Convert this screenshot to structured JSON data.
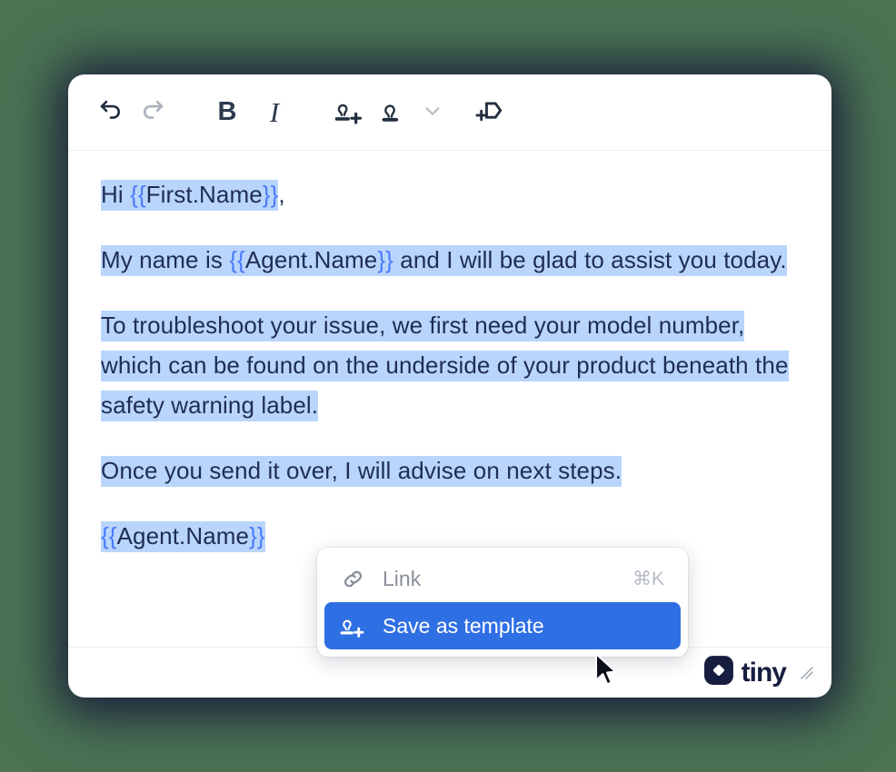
{
  "background_color": "#4a7353",
  "toolbar": {
    "buttons": [
      {
        "name": "undo",
        "label": "Undo",
        "icon": "undo-icon",
        "state": "enabled"
      },
      {
        "name": "redo",
        "label": "Redo",
        "icon": "redo-icon",
        "state": "disabled"
      },
      {
        "name": "bold",
        "label": "B",
        "icon": "bold-icon",
        "state": "enabled"
      },
      {
        "name": "italic",
        "label": "I",
        "icon": "italic-icon",
        "state": "enabled"
      },
      {
        "name": "save-as-template",
        "label": "Save as template",
        "icon": "stamp-plus-icon",
        "state": "enabled"
      },
      {
        "name": "insert-template",
        "label": "Insert template",
        "icon": "stamp-icon",
        "state": "enabled"
      },
      {
        "name": "template-options",
        "label": "Template options",
        "icon": "chevron-down-icon",
        "state": "enabled"
      },
      {
        "name": "insert-merge-tag",
        "label": "Insert merge tag",
        "icon": "tag-plus-icon",
        "state": "enabled"
      }
    ]
  },
  "document": {
    "paragraphs": [
      {
        "id": "greeting",
        "selected": true,
        "runs": [
          {
            "type": "text",
            "text": "Hi "
          },
          {
            "type": "merge-field",
            "text": "First.Name"
          },
          {
            "type": "text",
            "text": ",",
            "selected": false
          }
        ]
      },
      {
        "id": "intro",
        "selected": true,
        "runs": [
          {
            "type": "text",
            "text": "My name is "
          },
          {
            "type": "merge-field",
            "text": "Agent.Name"
          },
          {
            "type": "text",
            "text": " and I will be glad to assist you today."
          }
        ]
      },
      {
        "id": "troubleshoot",
        "selected": true,
        "runs": [
          {
            "type": "text",
            "text": "To troubleshoot your issue, we first need your model number, which can be found on the underside of your product beneath the safety warning label."
          }
        ]
      },
      {
        "id": "closing",
        "selected": true,
        "runs": [
          {
            "type": "text",
            "text": "Once you send it over, I will advise on next steps."
          }
        ]
      },
      {
        "id": "signature",
        "selected": true,
        "runs": [
          {
            "type": "merge-field",
            "text": "Agent.Name"
          }
        ]
      }
    ],
    "merge_field_open": "{{",
    "merge_field_close": "}}",
    "selection_color": "#b9d5fb",
    "text_color": "#1f2d54",
    "merge_field_brace_color": "#4a7afc"
  },
  "context_menu": {
    "items": [
      {
        "name": "link",
        "label": "Link",
        "shortcut": "⌘K",
        "icon": "link-icon",
        "active": false
      },
      {
        "name": "save-as-template",
        "label": "Save as template",
        "shortcut": "",
        "icon": "stamp-plus-icon",
        "active": true
      }
    ],
    "active_color": "#2f6fe4"
  },
  "footer": {
    "brand": "tiny",
    "brand_color": "#161d3f",
    "resize_handle": "resize-grip"
  }
}
